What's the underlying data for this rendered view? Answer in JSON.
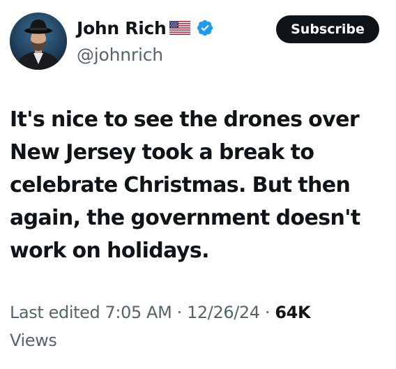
{
  "author": {
    "display_name": "John Rich",
    "handle": "@johnrich",
    "flag_icon": "us-flag-icon",
    "verified_icon": "verified-badge-icon",
    "verified_color": "#1d9bf0"
  },
  "actions": {
    "subscribe_label": "Subscribe"
  },
  "tweet": {
    "text_lines": [
      "It's nice to see the drones over",
      "New Jersey took a break to",
      "celebrate Christmas. But then",
      "again, the government doesn't",
      "work on holidays."
    ]
  },
  "meta": {
    "edited_label": "Last edited 7:05 AM · 12/26/24",
    "separator": " · ",
    "views_count": "64K",
    "views_label": "Views"
  },
  "colors": {
    "text_primary": "#0f1419",
    "text_secondary": "#536471",
    "button_bg": "#0f1419",
    "button_text": "#ffffff"
  }
}
